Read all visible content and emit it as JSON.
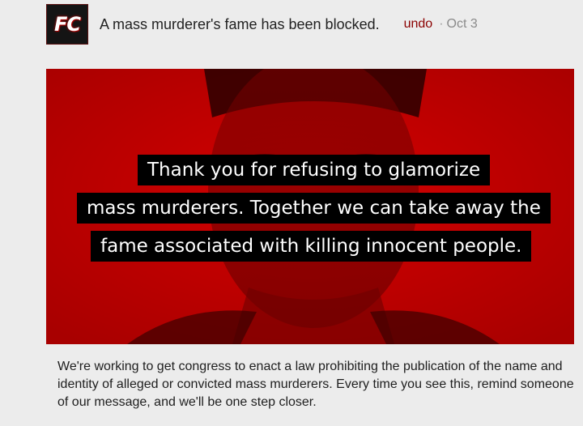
{
  "header": {
    "logo_text": "FC",
    "headline": "A mass murderer's fame has been blocked.",
    "undo_label": "undo",
    "separator": "·",
    "date": "Oct 3"
  },
  "banner": {
    "lines": [
      "Thank you for refusing to glamorize",
      "mass murderers. Together we can take away the",
      "fame associated with killing innocent people."
    ]
  },
  "body": {
    "text": "We're working to get congress to enact a law prohibiting the publication of the name and identity of alleged or convicted mass murderers. Every time you see this, remind someone of our message, and we'll be one step closer."
  },
  "colors": {
    "banner_red": "#c40000",
    "undo_red": "#8b0000",
    "background": "#ececec"
  }
}
